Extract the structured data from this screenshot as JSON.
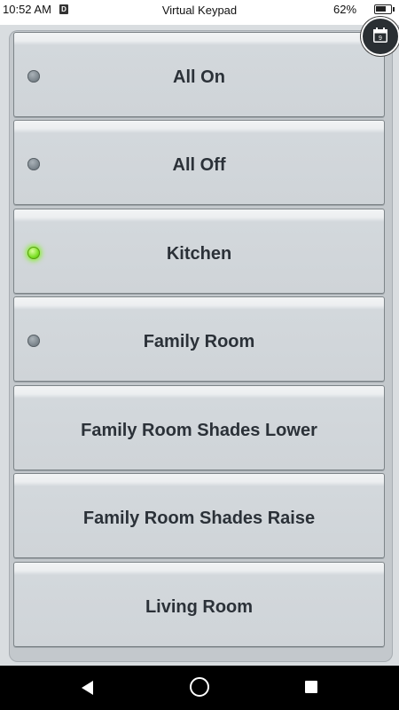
{
  "status_bar": {
    "time": "10:52 AM",
    "notification_glyph": "D",
    "title": "Virtual Keypad",
    "battery_percent": "62%"
  },
  "calendar": {
    "day": "9"
  },
  "keypad": {
    "buttons": [
      {
        "label": "All On",
        "has_led": true,
        "led_on": false
      },
      {
        "label": "All Off",
        "has_led": true,
        "led_on": false
      },
      {
        "label": "Kitchen",
        "has_led": true,
        "led_on": true
      },
      {
        "label": "Family Room",
        "has_led": true,
        "led_on": false
      },
      {
        "label": "Family Room Shades Lower",
        "has_led": false,
        "led_on": false
      },
      {
        "label": "Family Room Shades Raise",
        "has_led": false,
        "led_on": false
      },
      {
        "label": "Living Room",
        "has_led": false,
        "led_on": false
      }
    ]
  },
  "colors": {
    "led_on": "#7be024",
    "led_off": "#7a848b",
    "key_text": "#2b3138"
  },
  "icons": {
    "calendar": "calendar-icon",
    "back": "back-icon",
    "home": "home-icon",
    "recent": "recent-apps-icon"
  }
}
